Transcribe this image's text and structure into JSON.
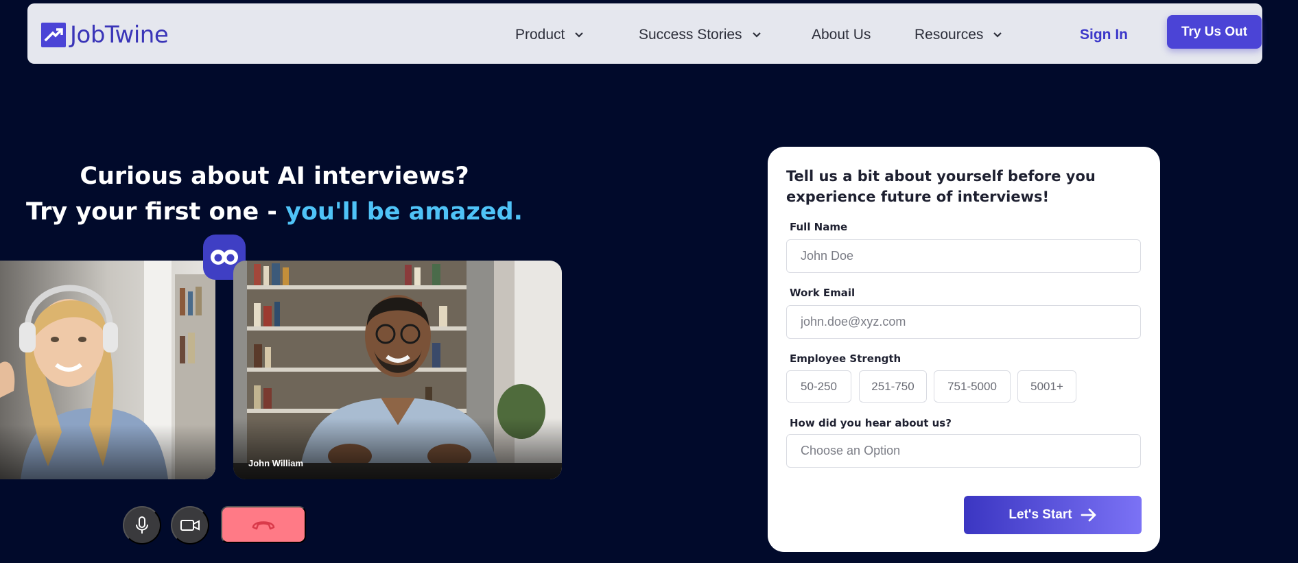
{
  "brand": {
    "name": "JobTwine",
    "color": "#4b44d6"
  },
  "nav": {
    "items": [
      {
        "label": "Product",
        "dropdown": true
      },
      {
        "label": "Success Stories",
        "dropdown": true
      },
      {
        "label": "About Us",
        "dropdown": false
      },
      {
        "label": "Resources",
        "dropdown": true
      }
    ],
    "sign_in": "Sign In",
    "cta": "Try Us Out"
  },
  "hero": {
    "line1": "Curious about AI interviews?",
    "line2_plain": "Try your first one - ",
    "line2_highlight": "you'll be amazed."
  },
  "call": {
    "participant_name": "John William",
    "controls": [
      "mic-icon",
      "video-camera-icon",
      "hang-up-icon"
    ],
    "end_color": "#ff7a86"
  },
  "form": {
    "title": "Tell us a bit about yourself before you experience future of interviews!",
    "full_name": {
      "label": "Full Name",
      "placeholder": "John Doe"
    },
    "work_email": {
      "label": "Work Email",
      "placeholder": "john.doe@xyz.com"
    },
    "employee_strength": {
      "label": "Employee Strength",
      "options": [
        "50-250",
        "251-750",
        "751-5000",
        "5001+"
      ]
    },
    "referral": {
      "label": "How did you hear about us?",
      "placeholder": "Choose an Option"
    },
    "submit": "Let's Start"
  }
}
